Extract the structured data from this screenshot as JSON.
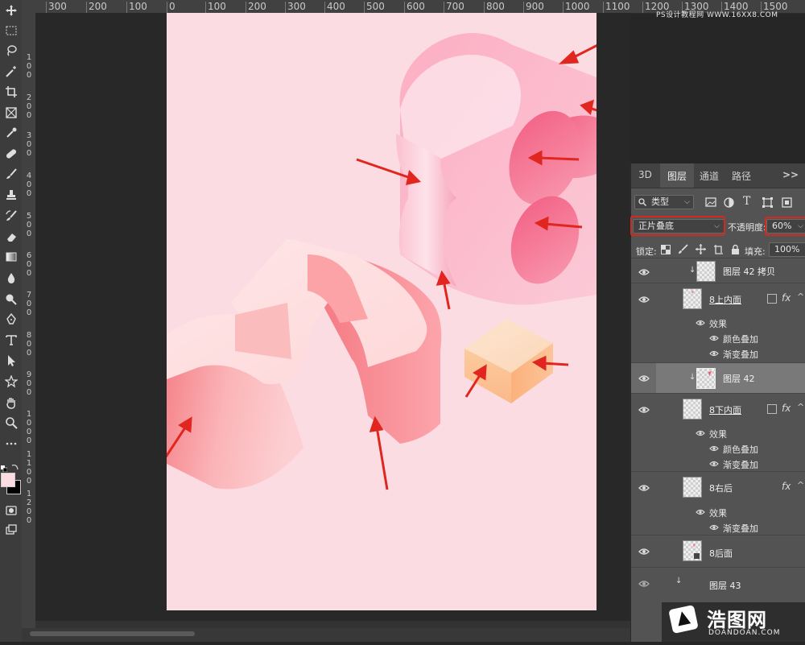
{
  "ruler_top": [
    "300",
    "200",
    "100",
    "0",
    "100",
    "200",
    "300",
    "400",
    "500",
    "600",
    "700",
    "800",
    "900",
    "1000",
    "1100",
    "1200",
    "1300",
    "1400",
    "1500"
  ],
  "ruler_left": [
    {
      "d": [
        "1",
        "0",
        "0"
      ]
    },
    {
      "d": [
        "2",
        "0",
        "0"
      ]
    },
    {
      "d": [
        "3",
        "0",
        "0"
      ]
    },
    {
      "d": [
        "4",
        "0",
        "0"
      ]
    },
    {
      "d": [
        "5",
        "0",
        "0"
      ]
    },
    {
      "d": [
        "6",
        "0",
        "0"
      ]
    },
    {
      "d": [
        "7",
        "0",
        "0"
      ]
    },
    {
      "d": [
        "8",
        "0",
        "0"
      ]
    },
    {
      "d": [
        "9",
        "0",
        "0"
      ]
    },
    {
      "d": [
        "1",
        "0",
        "0",
        "0"
      ]
    },
    {
      "d": [
        "1",
        "1",
        "0",
        "0"
      ]
    },
    {
      "d": [
        "1",
        "2",
        "0",
        "0"
      ]
    }
  ],
  "toolbar": {
    "tools": [
      "move-icon",
      "marquee-icon",
      "lasso-icon",
      "magic-wand-icon",
      "crop-icon",
      "frame-icon",
      "eyedropper-icon",
      "healing-brush-icon",
      "brush-icon",
      "clone-stamp-icon",
      "history-brush-icon",
      "eraser-icon",
      "gradient-icon",
      "blur-icon",
      "dodge-icon",
      "pen-icon",
      "type-icon",
      "path-select-icon",
      "custom-shape-icon",
      "hand-icon",
      "zoom-icon",
      "more-tools-icon"
    ],
    "foreground_color": "#fcdce3",
    "background_color": "#000000"
  },
  "canvas": {
    "background": "#fcdce3",
    "artwork": "3D text 3 and 8 with isometric cube",
    "arrow_color": "#e0261e"
  },
  "layers_panel": {
    "tabs": [
      "3D",
      "图层",
      "通道",
      "路径"
    ],
    "active_tab": "图层",
    "tab_menu": ">>",
    "filter": {
      "label": "类型",
      "icon": "search-icon"
    },
    "blend_mode": "正片叠底",
    "opacity_label": "不透明度:",
    "opacity_value": "60%",
    "lock_label": "锁定:",
    "fill_label": "填充:",
    "fill_value": "100%",
    "layers": [
      {
        "name": "图层 42 拷贝",
        "clipped": true
      },
      {
        "name": "8上内面",
        "underline": true,
        "fx": "fx",
        "effects_label": "效果",
        "effects": [
          "颜色叠加",
          "渐变叠加"
        ]
      },
      {
        "name": "图层 42",
        "clipped": true,
        "selected": true
      },
      {
        "name": "8下内面",
        "underline": true,
        "fx": "fx",
        "effects_label": "效果",
        "effects": [
          "颜色叠加",
          "渐变叠加"
        ]
      },
      {
        "name": "8右后",
        "fx": "fx",
        "effects_label": "效果",
        "effects": [
          "渐变叠加"
        ]
      },
      {
        "name": "8后面"
      },
      {
        "name": "图层 43",
        "clipped": true
      }
    ]
  },
  "watermark": {
    "top": "PS设计教程网 WWW.16XX8.COM",
    "logo": "浩图网",
    "logo_sub": "DOANDOAN.COM"
  }
}
